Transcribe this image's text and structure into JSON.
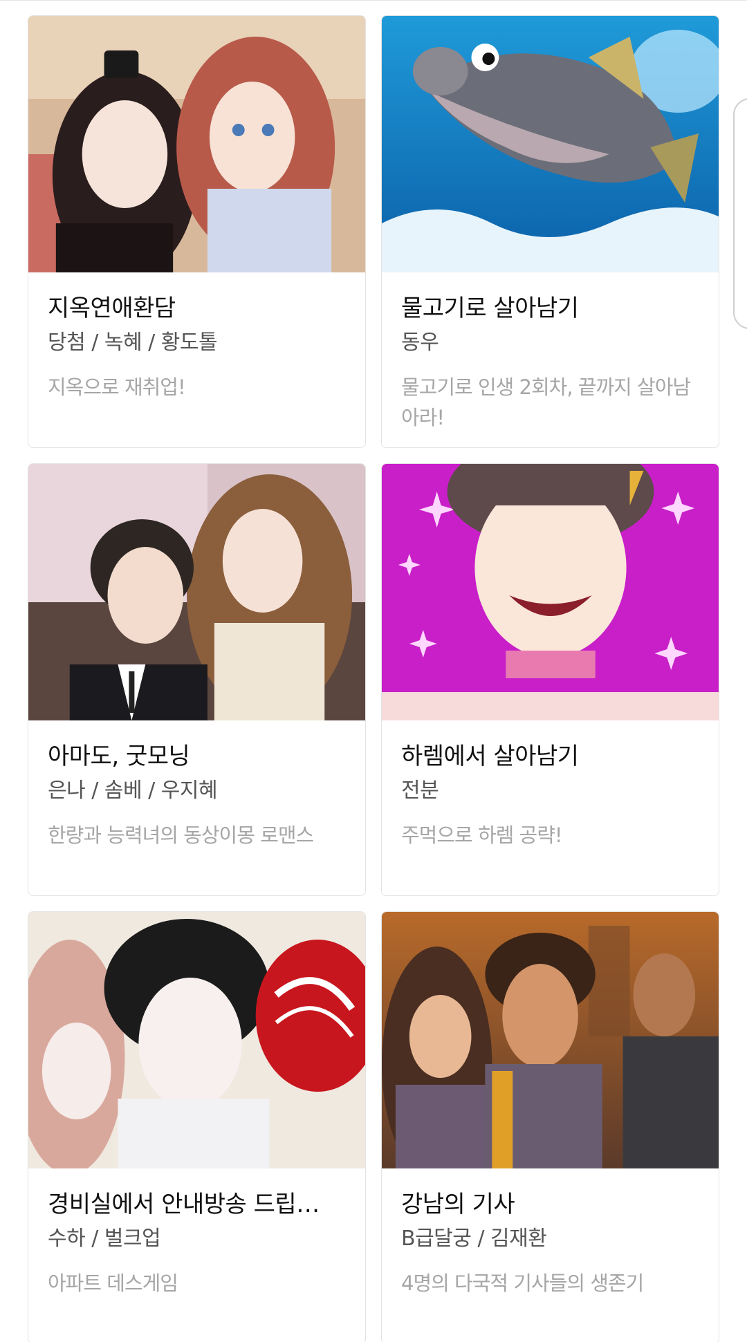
{
  "cards": [
    {
      "title": "지옥연애환담",
      "authors": "당첨 / 녹혜 / 황도톨",
      "description": "지옥으로 재취업!",
      "thumb_icon": "romance-fantasy-couple-image"
    },
    {
      "title": "물고기로 살아남기",
      "authors": "동우",
      "description": "물고기로 인생 2회차, 끝까지 살아남아라!",
      "thumb_icon": "jumping-fish-image"
    },
    {
      "title": "아마도, 굿모닝",
      "authors": "은나 / 솜베 / 우지혜",
      "description": "한량과 능력녀의 동상이몽 로맨스",
      "thumb_icon": "office-couple-image"
    },
    {
      "title": "하렘에서 살아남기",
      "authors": "전분",
      "description": "주먹으로 하렘 공략!",
      "thumb_icon": "crying-boy-sparkles-image"
    },
    {
      "title": "경비실에서 안내방송 드립…",
      "authors": "수하 / 벌크업",
      "description": "아파트 데스게임",
      "thumb_icon": "security-guard-action-image"
    },
    {
      "title": "강남의 기사",
      "authors": "B급달궁 / 김재환",
      "description": "4명의 다국적 기사들의 생존기",
      "thumb_icon": "gangnam-knights-image"
    }
  ]
}
